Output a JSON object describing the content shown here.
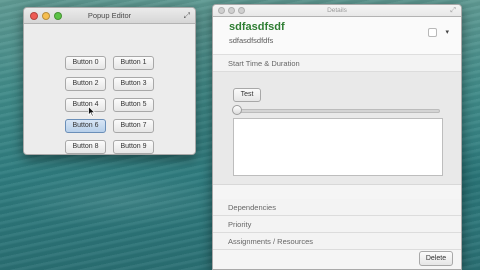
{
  "popup_window": {
    "title": "Popup Editor",
    "buttons": [
      "Button 0",
      "Button 1",
      "Button 2",
      "Button 3",
      "Button 4",
      "Button 5",
      "Button 6",
      "Button 7",
      "Button 8",
      "Button 9"
    ],
    "hovered_button": "Button 6"
  },
  "details_window": {
    "title": "Details",
    "task_title": "sdfasdfsdf",
    "task_subtitle": "sdfasdfsdfdfs",
    "sections": {
      "start_time": "Start Time & Duration",
      "dependencies": "Dependencies",
      "priority": "Priority",
      "assignments": "Assignments / Resources"
    },
    "test_button": "Test",
    "slider_value": 0,
    "text_area_value": "",
    "delete_button": "Delete"
  },
  "colors": {
    "title_green": "#2e7d32",
    "desktop": "#3f8a88",
    "close": "#ee5b54",
    "minimize": "#f6be4f",
    "maximize": "#5cc346"
  },
  "icons": {
    "fullscreen": "⤢",
    "dropdown": "▾"
  }
}
